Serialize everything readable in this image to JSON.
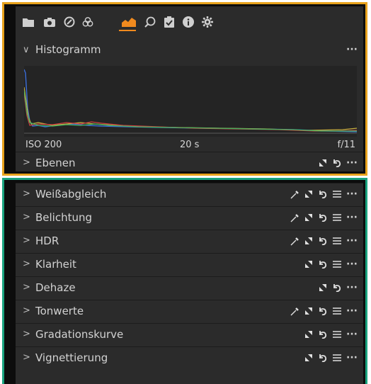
{
  "toolbar": {
    "icons": [
      "folder-icon",
      "camera-icon",
      "lens-icon",
      "color-icon",
      "exposure-icon",
      "loupe-icon",
      "metadata-icon",
      "info-icon",
      "settings-icon"
    ],
    "active_color": "#f08a1e"
  },
  "histogram": {
    "title": "Histogramm",
    "iso": "ISO 200",
    "shutter": "20 s",
    "aperture": "f/11"
  },
  "layers": {
    "title": "Ebenen"
  },
  "sections": [
    {
      "label": "Weißabgleich",
      "picker": true,
      "menu": true
    },
    {
      "label": "Belichtung",
      "picker": true,
      "menu": true
    },
    {
      "label": "HDR",
      "picker": true,
      "menu": true
    },
    {
      "label": "Klarheit",
      "picker": false,
      "menu": true
    },
    {
      "label": "Dehaze",
      "picker": false,
      "menu": false
    },
    {
      "label": "Tonwerte",
      "picker": true,
      "menu": true
    },
    {
      "label": "Gradationskurve",
      "picker": false,
      "menu": true
    },
    {
      "label": "Vignettierung",
      "picker": false,
      "menu": true
    }
  ],
  "colors": {
    "accent_orange": "#e8a21c",
    "accent_green": "#1aa37f",
    "panel_bg": "#2b2b2b"
  }
}
